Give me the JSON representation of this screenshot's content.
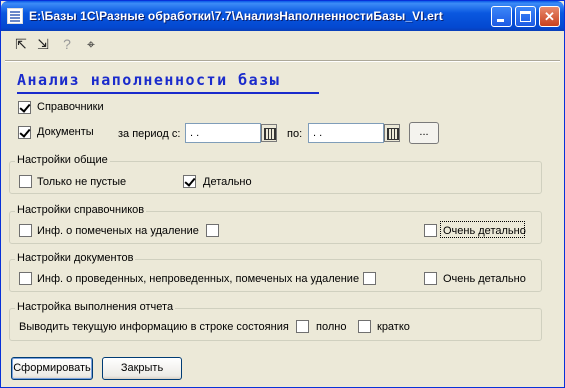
{
  "window": {
    "title": "E:\\Базы 1С\\Разные обработки\\7.7\\АнализНаполненностиБазы_VI.ert",
    "minimize_label": "_",
    "maximize_label": "□",
    "close_label": "✕"
  },
  "toolbar": {
    "tool1_glyph": "⇱",
    "tool2_glyph": "⇲",
    "tool3_glyph": "?",
    "tool4_glyph": "⌖"
  },
  "heading": "Анализ наполненности базы",
  "main": {
    "catalogs_label": "Справочники",
    "catalogs_checked": true,
    "documents_label": "Документы",
    "documents_checked": true,
    "period_from_label": "за период с:",
    "period_from_value": " .  .",
    "period_to_label": "по:",
    "period_to_value": " .  .",
    "ellipsis_label": "..."
  },
  "groups": {
    "general": {
      "title": "Настройки общие",
      "nonempty_label": "Только не пустые",
      "nonempty_checked": false,
      "detailed_label": "Детально",
      "detailed_checked": true
    },
    "catalogs": {
      "title": "Настройки справочников",
      "marked_label": "Инф. о помеченых на  удаление",
      "very_detailed_label": "Очень детально"
    },
    "documents": {
      "title": "Настройки документов",
      "posted_label": "Инф. о проведенных, непроведенных, помеченых на удаление",
      "very_detailed_label": "Очень детально"
    },
    "report": {
      "title": "Настройка выполнения отчета",
      "status_label": "Выводить текущую информацию в строке состояния",
      "full_label": "полно",
      "brief_label": "кратко"
    }
  },
  "buttons": {
    "generate": "Сформировать",
    "close": "Закрыть"
  },
  "icons": [
    "window-icon",
    "calendar-icon"
  ]
}
